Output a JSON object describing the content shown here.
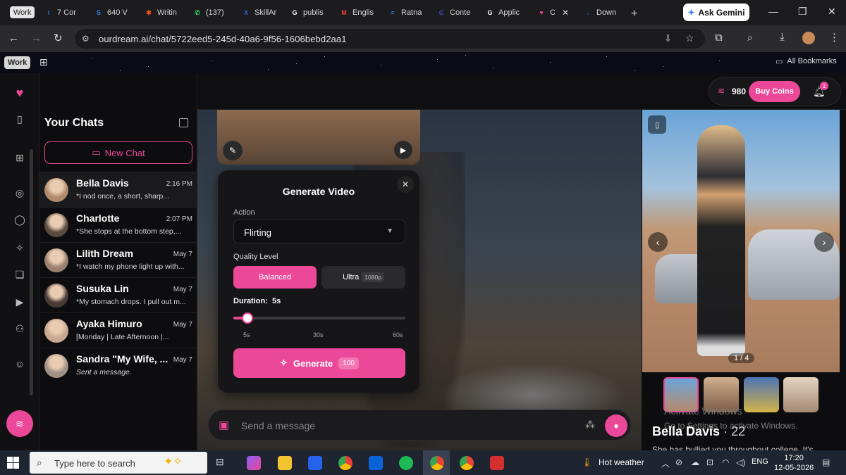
{
  "browser": {
    "tabs": [
      {
        "label": "7 Cor",
        "fav": "i",
        "color": "#1a73e8"
      },
      {
        "label": "640 V",
        "fav": "S",
        "color": "#1e88e5"
      },
      {
        "label": "Writin",
        "fav": "✱",
        "color": "#f4511e"
      },
      {
        "label": "(137)",
        "fav": "✆",
        "color": "#25d366"
      },
      {
        "label": "SkillAr",
        "fav": "X",
        "color": "#3b5bdb"
      },
      {
        "label": "publis",
        "fav": "G",
        "color": "#ffffff"
      },
      {
        "label": "Englis",
        "fav": "M",
        "color": "#ea4335"
      },
      {
        "label": "Ratna",
        "fav": "≡",
        "color": "#4285f4"
      },
      {
        "label": "Conte",
        "fav": "C",
        "color": "#4f46e5"
      },
      {
        "label": "Applic",
        "fav": "G",
        "color": "#fff"
      },
      {
        "label": "C",
        "fav": "♥",
        "color": "#ec4899"
      },
      {
        "label": "Down",
        "fav": "↓",
        "color": "#1a73e8"
      }
    ],
    "work_chip": "Work",
    "ask_gemini": "Ask Gemini",
    "url": "ourdream.ai/chat/5722eed5-245d-40a6-9f56-1606bebd2aa1",
    "work_badge": "Work",
    "all_bookmarks": "All Bookmarks"
  },
  "sidebar": {
    "title": "Your Chats",
    "new_chat": "New Chat",
    "chats": [
      {
        "name": "Bella Davis",
        "time": "2:16 PM",
        "preview": "*I nod once, a short, sharp...",
        "color": "#b08a6c"
      },
      {
        "name": "Charlotte",
        "time": "2:07 PM",
        "preview": "*She stops at the bottom step,...",
        "color": "#5a4a40"
      },
      {
        "name": "Lilith Dream",
        "time": "May 7",
        "preview": "*I watch my phone light up with...",
        "color": "#9a8070"
      },
      {
        "name": "Susuka Lin",
        "time": "May 7",
        "preview": "*My stomach drops. I pull out m...",
        "color": "#4a3a35"
      },
      {
        "name": "Ayaka Himuro",
        "time": "May 7",
        "preview": "[Monday | Late Afternoon |...",
        "color": "#c8a890"
      },
      {
        "name": "Sandra \"My Wife, ...",
        "time": "May 7",
        "preview": "Sent a message.",
        "color": "#a09088"
      }
    ]
  },
  "topbar": {
    "coins": "980",
    "buy_coins": "Buy Coins",
    "notifications": "1"
  },
  "modal": {
    "title": "Generate Video",
    "action_label": "Action",
    "action_value": "Flirting",
    "quality_label": "Quality Level",
    "quality_balanced": "Balanced",
    "quality_ultra": "Ultra",
    "quality_ultra_badge": "1080p",
    "duration_label": "Duration:",
    "duration_value": "5s",
    "duration_fraction": 0.0,
    "ticks": [
      "5s",
      "30s",
      "60s"
    ],
    "generate": "Generate",
    "generate_cost": "100"
  },
  "message": {
    "placeholder": "Send a message"
  },
  "profile": {
    "name": "Bella Davis",
    "age": "· 22",
    "bio": "She has bullied you throughout college. It's",
    "photo_counter": "1 / 4",
    "watermark_1": "Activate Windows",
    "watermark_2": "Go to Settings to activate Windows."
  },
  "taskbar": {
    "search": "Type here to search",
    "weather": "Hot weather",
    "lang": "ENG",
    "time": "17:20",
    "date": "12-05-2026"
  },
  "colors": {
    "accent": "#ec4899"
  }
}
